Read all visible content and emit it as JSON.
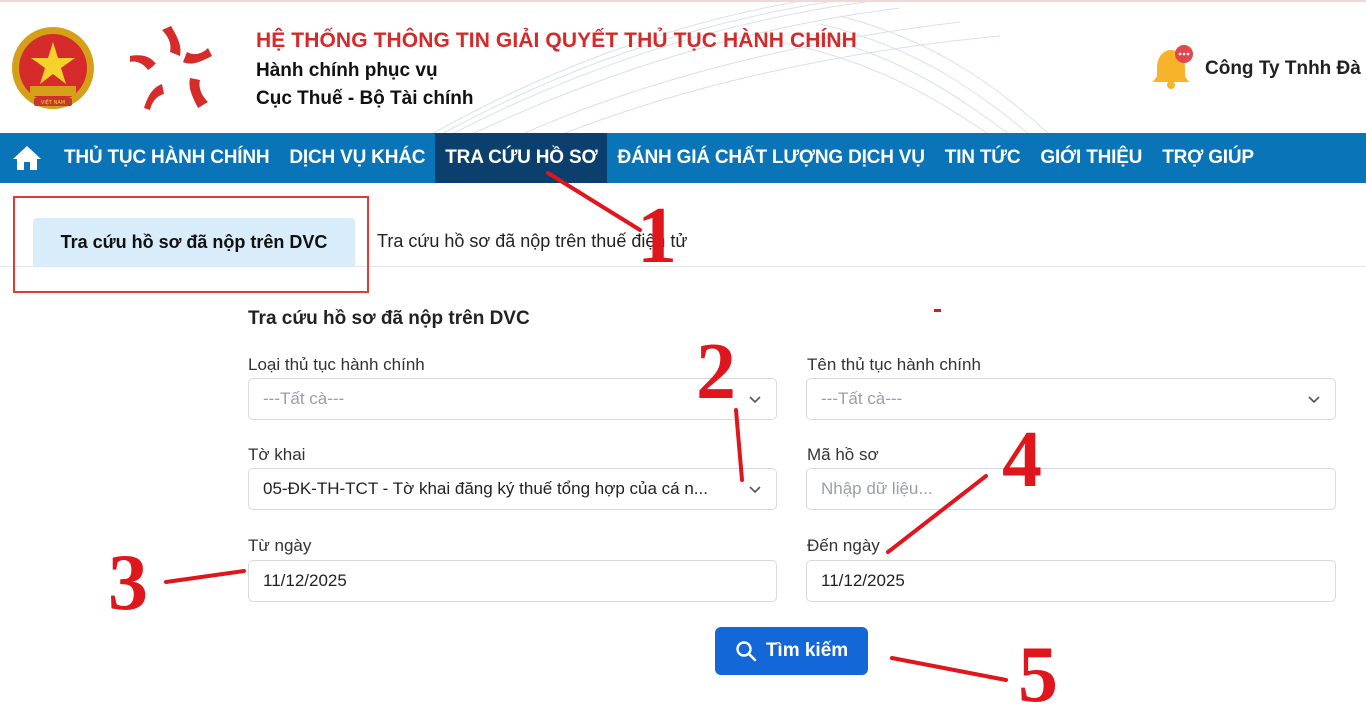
{
  "header": {
    "system_title": "HỆ THỐNG THÔNG TIN GIẢI QUYẾT THỦ TỤC HÀNH CHÍNH",
    "subtitle_line1": "Hành chính phục vụ",
    "subtitle_line2": "Cục Thuế - Bộ Tài chính",
    "user_name": "Công Ty Tnhh Đà",
    "bell_icon": "bell-icon",
    "emblem_icon": "national-emblem-icon",
    "logo_icon": "service-star-logo-icon"
  },
  "nav": {
    "home_icon": "home-icon",
    "items": [
      {
        "label": "THỦ TỤC HÀNH CHÍNH",
        "active": false
      },
      {
        "label": "DỊCH VỤ KHÁC",
        "active": false
      },
      {
        "label": "TRA CỨU HỒ SƠ",
        "active": true
      },
      {
        "label": "ĐÁNH GIÁ CHẤT LƯỢNG DỊCH VỤ",
        "active": false
      },
      {
        "label": "TIN TỨC",
        "active": false
      },
      {
        "label": "GIỚI THIỆU",
        "active": false
      },
      {
        "label": "TRỢ GIÚP",
        "active": false
      }
    ]
  },
  "tabs": {
    "active": "Tra cứu hồ sơ đã nộp trên DVC",
    "other": "Tra cứu hồ sơ đã nộp trên thuế điện tử"
  },
  "form": {
    "title": "Tra cứu hồ sơ đã nộp trên DVC",
    "procedure_type": {
      "label": "Loại thủ tục hành chính",
      "placeholder": "---Tất cà---"
    },
    "procedure_name": {
      "label": "Tên thủ tục hành chính",
      "placeholder": "---Tất cà---"
    },
    "declaration": {
      "label": "Tờ khai",
      "value": "05-ĐK-TH-TCT - Tờ khai đăng ký thuế tổng hợp của cá n..."
    },
    "file_code": {
      "label": "Mã hồ sơ",
      "placeholder": "Nhập dữ liệu..."
    },
    "from_date": {
      "label": "Từ ngày",
      "value": "11/12/2025"
    },
    "to_date": {
      "label": "Đến ngày",
      "value": "11/12/2025"
    },
    "search_button": "Tìm kiếm",
    "search_icon": "search-icon"
  },
  "annotations": {
    "step1": "1",
    "step2": "2",
    "step3": "3",
    "step4": "4",
    "step5": "5",
    "color": "#e0161d"
  },
  "colors": {
    "nav_bg": "#0a74b8",
    "nav_active": "#0b3f6d",
    "title_red": "#d42a2a",
    "tab_active_bg": "#d8ecfa",
    "button_blue": "#1467d6"
  }
}
